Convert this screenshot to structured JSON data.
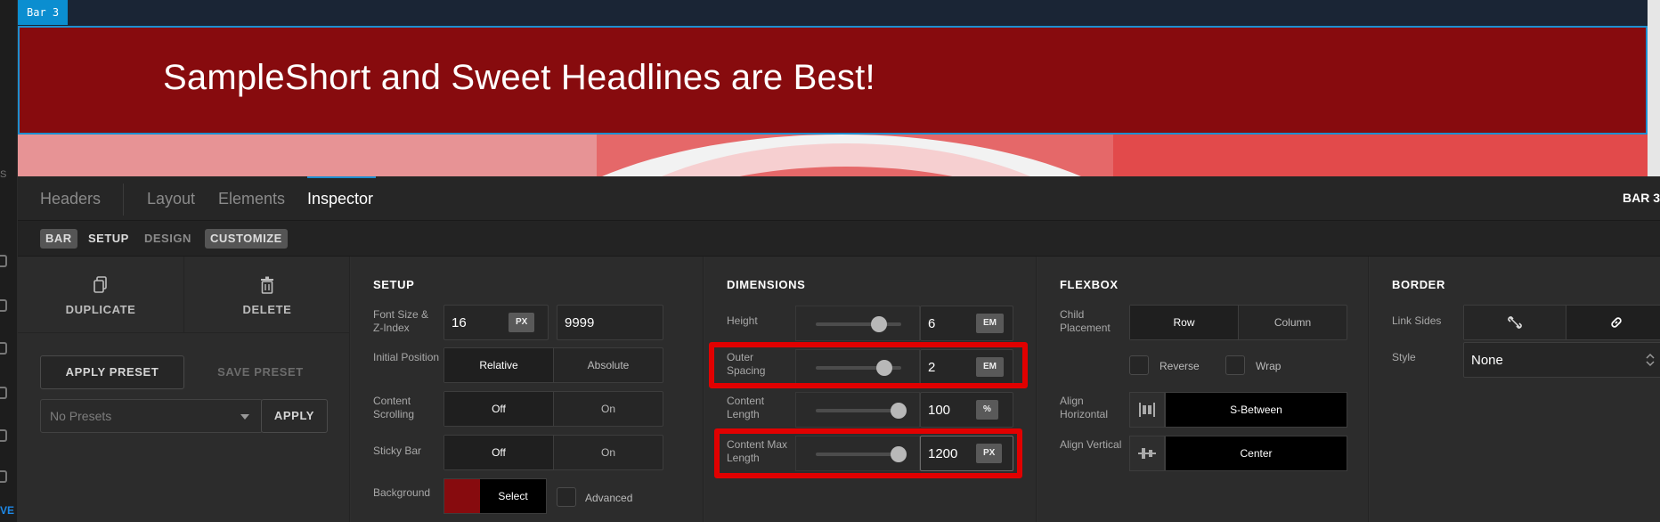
{
  "preview": {
    "bar_tag": "Bar 3",
    "headline": "SampleShort and Sweet Headlines are Best!"
  },
  "tabs": [
    {
      "label": "Headers"
    },
    {
      "label": "Layout"
    },
    {
      "label": "Elements"
    },
    {
      "label": "Inspector",
      "active": true
    }
  ],
  "tab_right": "BAR 3",
  "subtabs": {
    "bar": "BAR",
    "setup": "SETUP",
    "design": "DESIGN",
    "customize": "CUSTOMIZE"
  },
  "actions": {
    "duplicate": "DUPLICATE",
    "delete": "DELETE",
    "apply_preset": "APPLY PRESET",
    "save_preset": "SAVE PRESET",
    "presets_placeholder": "No Presets",
    "apply": "APPLY"
  },
  "setup": {
    "title": "SETUP",
    "font_label": "Font Size & Z-Index",
    "font_size": "16",
    "font_unit": "PX",
    "z_index": "9999",
    "position_label": "Initial Position",
    "position_options": [
      "Relative",
      "Absolute"
    ],
    "scrolling_label": "Content Scrolling",
    "scrolling_options": [
      "Off",
      "On"
    ],
    "sticky_label": "Sticky Bar",
    "sticky_options": [
      "Off",
      "On"
    ],
    "background_label": "Background",
    "background_select": "Select",
    "background_color": "#870b0e",
    "advanced_label": "Advanced"
  },
  "dimensions": {
    "title": "DIMENSIONS",
    "height": {
      "label": "Height",
      "value": "6",
      "unit": "EM",
      "slider": 0.75
    },
    "outer_spacing": {
      "label": "Outer Spacing",
      "value": "2",
      "unit": "EM",
      "slider": 0.8
    },
    "content_length": {
      "label": "Content Length",
      "value": "100",
      "unit": "%",
      "slider": 1.0
    },
    "content_max_length": {
      "label": "Content Max Length",
      "value": "1200",
      "unit": "PX",
      "slider": 1.0
    }
  },
  "flexbox": {
    "title": "FLEXBOX",
    "child_placement_label": "Child Placement",
    "placement_options": [
      "Row",
      "Column"
    ],
    "reverse_label": "Reverse",
    "wrap_label": "Wrap",
    "align_h_label": "Align Horizontal",
    "align_h_value": "S-Between",
    "align_v_label": "Align Vertical",
    "align_v_value": "Center"
  },
  "border": {
    "title": "BORDER",
    "link_sides_label": "Link Sides",
    "style_label": "Style",
    "style_value": "None"
  },
  "colors": {
    "accent": "#1e8fd0",
    "highlight": "#e10000",
    "bar_red": "#870b0e"
  }
}
